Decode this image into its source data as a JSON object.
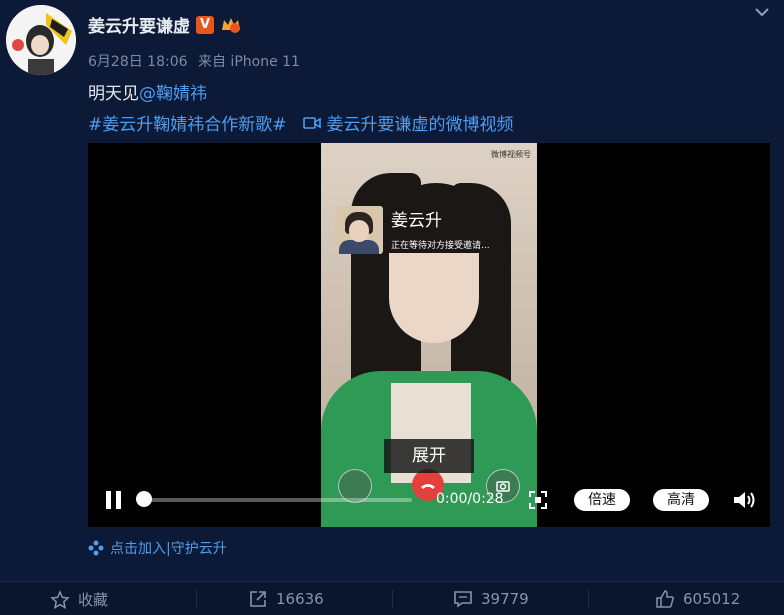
{
  "author": {
    "name": "姜云升要谦虚",
    "badge": "V"
  },
  "meta": {
    "date": "6月28日 18:06",
    "source": "来自 iPhone 11"
  },
  "post": {
    "text": "明天见",
    "mention": "@鞠婧祎",
    "hashtag": "#姜云升鞠婧祎合作新歌#",
    "video_link": "姜云升要谦虚的微博视频"
  },
  "video": {
    "caller_name": "姜云升",
    "caller_sub": "正在等待对方接受邀请...",
    "watermark": "微博视频号",
    "expand_label": "展开",
    "time": "0:00/0:28",
    "progress": 0.0,
    "speed_label": "倍速",
    "quality_label": "高清"
  },
  "join": {
    "label": "点击加入|守护云升"
  },
  "footer": {
    "favorite": "收藏",
    "shares": "16636",
    "comments": "39779",
    "likes": "605012"
  },
  "colors": {
    "background": "#0c1a37",
    "link": "#4f9cf0",
    "badge": "#e8561b"
  }
}
